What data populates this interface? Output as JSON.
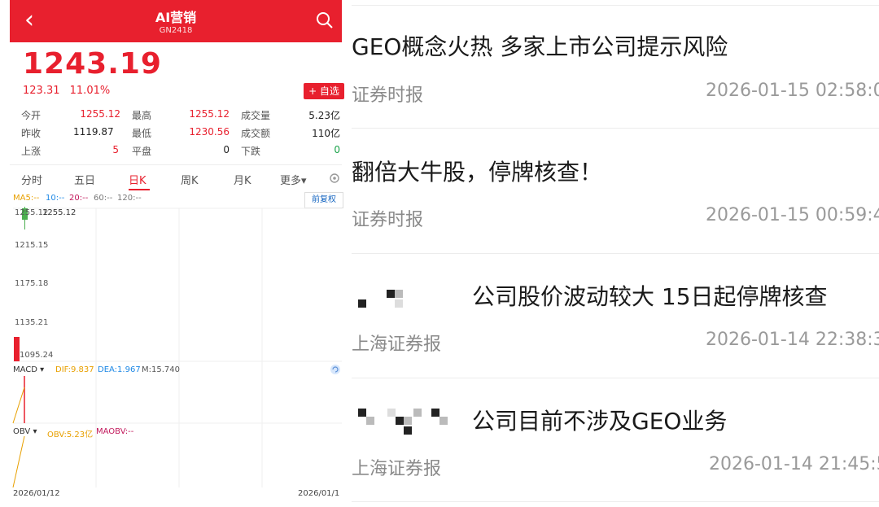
{
  "header": {
    "title": "AI营销",
    "code": "GN2418"
  },
  "quote": {
    "price": "1243.19",
    "change": "123.31",
    "change_pct": "11.01%",
    "add_label": "+ 自选"
  },
  "stats": [
    {
      "label": "今开",
      "value": "1255.12",
      "color": "red"
    },
    {
      "label": "最高",
      "value": "1255.12",
      "color": "red"
    },
    {
      "label": "成交量",
      "value": "5.23亿",
      "color": "black"
    },
    {
      "label": "昨收",
      "value": "1119.87",
      "color": "black"
    },
    {
      "label": "最低",
      "value": "1230.56",
      "color": "red"
    },
    {
      "label": "成交额",
      "value": "110亿",
      "color": "black"
    },
    {
      "label": "上涨",
      "value": "5",
      "color": "red"
    },
    {
      "label": "平盘",
      "value": "0",
      "color": "black"
    },
    {
      "label": "下跌",
      "value": "0",
      "color": "green"
    }
  ],
  "tabs": [
    "分时",
    "五日",
    "日K",
    "周K",
    "月K",
    "更多▾"
  ],
  "active_tab": "日K",
  "ma_legend": [
    {
      "label": "MA5:--",
      "color": "#e8a000"
    },
    {
      "label": "10:--",
      "color": "#1e88e5"
    },
    {
      "label": "20:--",
      "color": "#c2185b"
    },
    {
      "label": "60:--",
      "color": "#777777"
    },
    {
      "label": "120:--",
      "color": "#777777"
    }
  ],
  "fuquan": "前复权",
  "price_axis": [
    "1255.12",
    "1215.15",
    "1175.18",
    "1135.21",
    "1095.24"
  ],
  "candle_high_label": "1255.12",
  "macd": {
    "name": "MACD ▾",
    "dif": "DIF:9.837",
    "dea": "DEA:1.967",
    "m": "M:15.740"
  },
  "obv": {
    "name": "OBV ▾",
    "obv": "OBV:5.23亿",
    "maobv": "MAOBV:--"
  },
  "dates": [
    "2026/01/12",
    "2026/01/1"
  ],
  "news": [
    {
      "title": "GEO概念火热 多家上市公司提示风险",
      "source": "证券时报",
      "time": "2026-01-15 02:58:0"
    },
    {
      "title": "翻倍大牛股，停牌核查！",
      "source": "证券时报",
      "time": "2026-01-15 00:59:4"
    },
    {
      "title": "公司股价波动较大 15日起停牌核查",
      "source": "上海证券报",
      "time": "2026-01-14 22:38:3"
    },
    {
      "title": "公司目前不涉及GEO业务",
      "source": "上海证券报",
      "time": "2026-01-14 21:45:5"
    }
  ],
  "colors": {
    "accent": "#e8202e",
    "up": "#e8202e",
    "down": "#1aa34a"
  }
}
